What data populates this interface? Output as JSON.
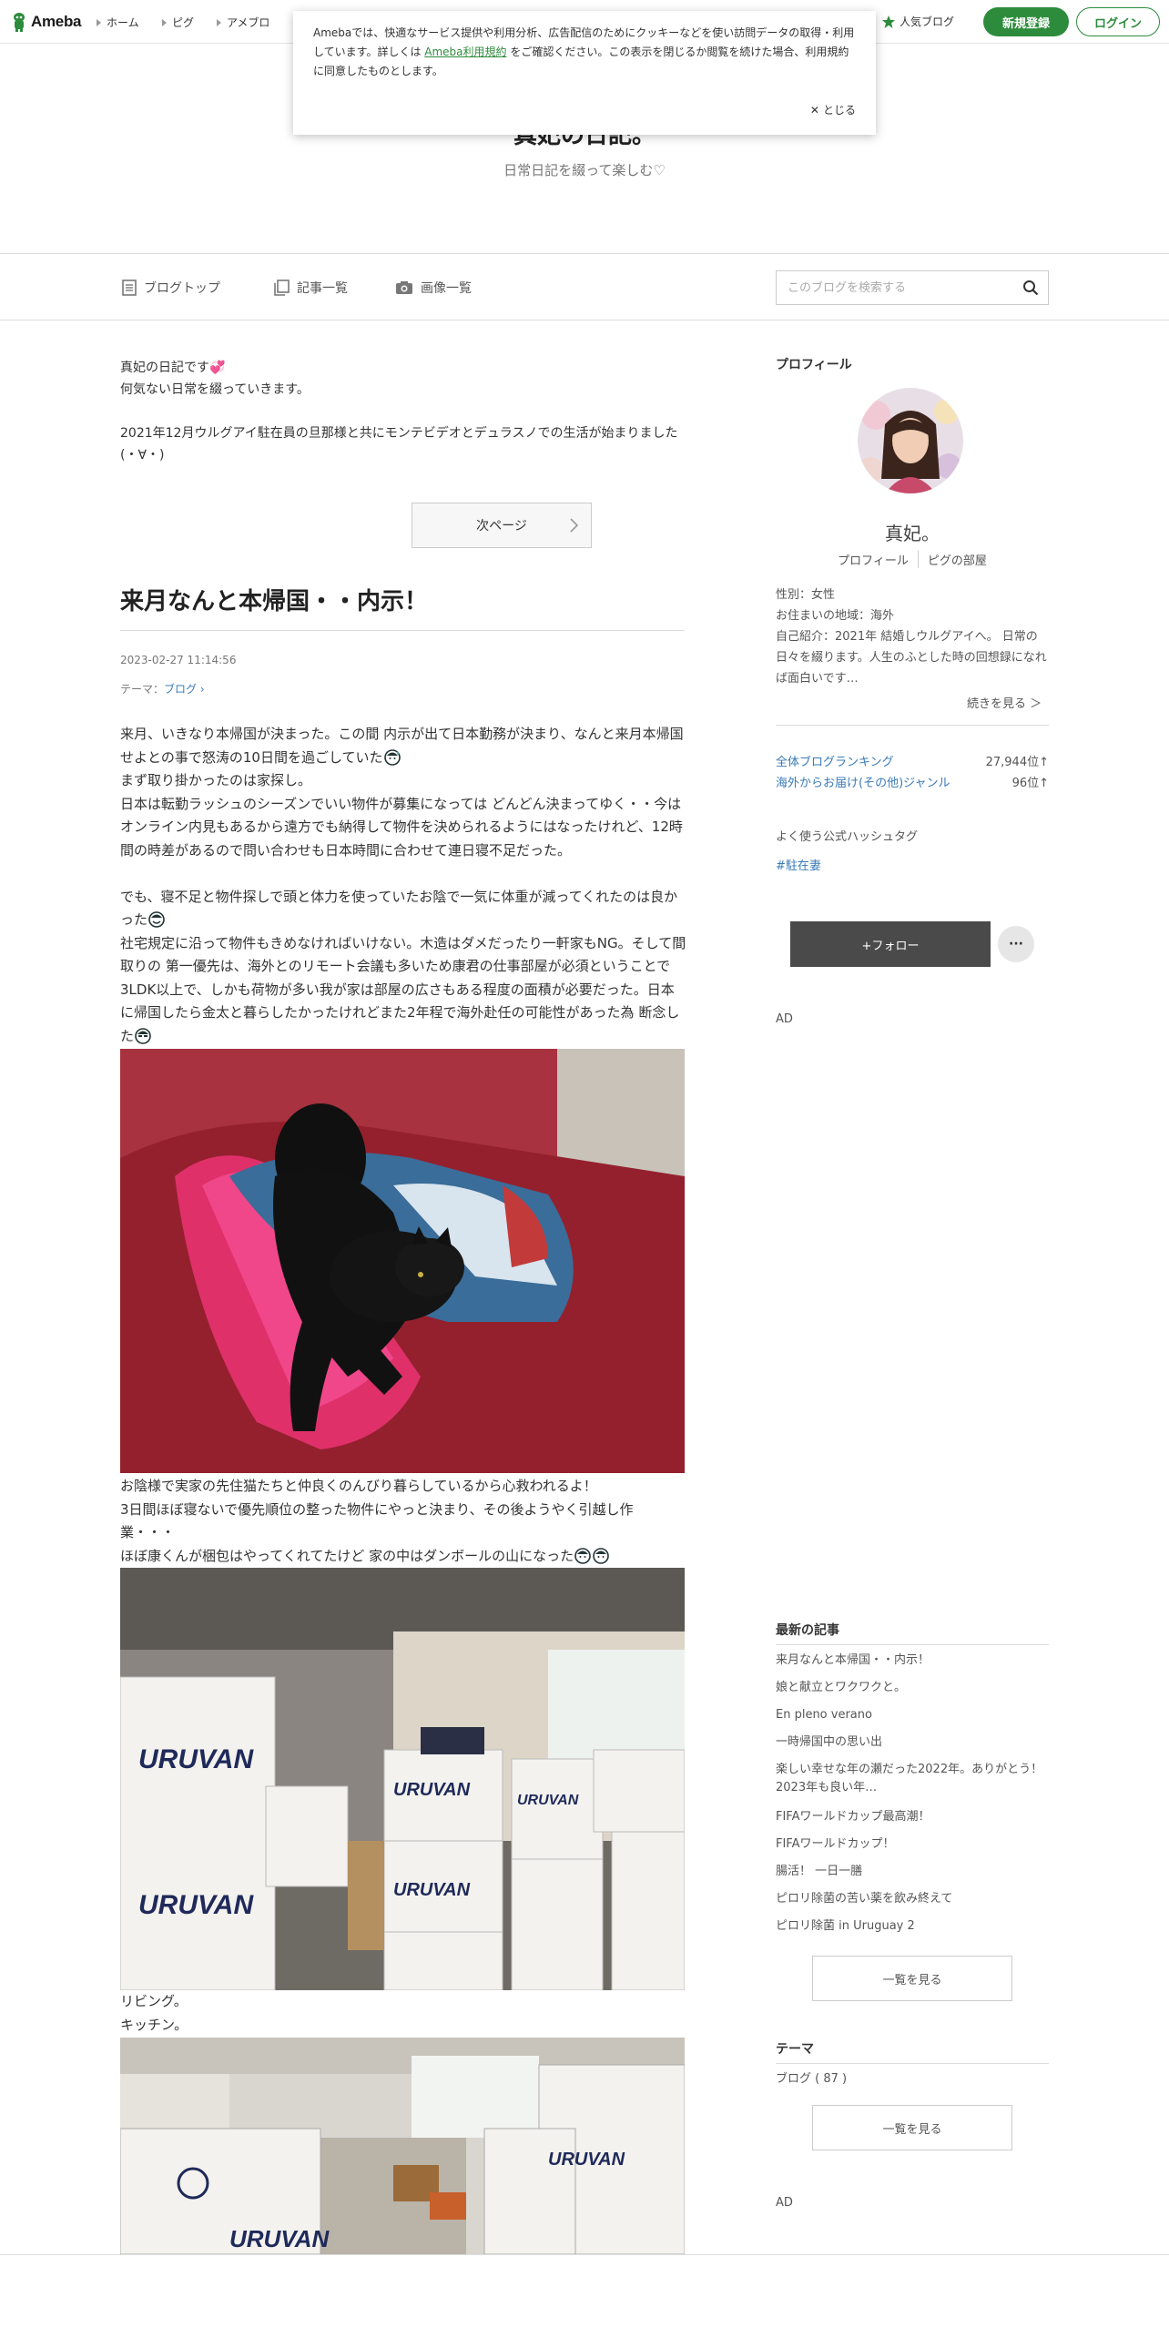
{
  "header": {
    "logo_text": "Ameba",
    "nav": [
      "ホーム",
      "ピグ",
      "アメブロ"
    ],
    "popular_label": "人気ブログ",
    "signup_label": "新規登録",
    "login_label": "ログイン"
  },
  "cookie_banner": {
    "text_1": "Amebaでは、快適なサービス提供や利用分析、広告配信のためにクッキーなどを使い訪問データの取得・利用しています。詳しくは ",
    "link": "Ameba利用規約",
    "text_2": " をご確認ください。この表示を閉じるか閲覧を続けた場合、利用規約に同意したものとします。",
    "close_label": "とじる"
  },
  "blog": {
    "title": "真妃の日記。",
    "description": "日常日記を綴って楽しむ♡"
  },
  "blog_nav": {
    "items": [
      "ブログトップ",
      "記事一覧",
      "画像一覧"
    ],
    "search_placeholder": "このブログを検索する"
  },
  "intro": {
    "line1": "真妃の日記です",
    "line2": "何気ない日常を綴っていきます。",
    "line3": "2021年12月ウルグアイ駐在員の旦那様と共にモンテビデオとデュラスノでの生活が始まりました",
    "line4": "(・∀・)"
  },
  "next_page_label": "次ページ",
  "entry": {
    "title": "来月なんと本帰国・・内示！",
    "date": "2023-02-27 11:14:56",
    "theme_prefix": "テーマ：",
    "theme": "ブログ",
    "p1": "来月、いきなり本帰国が決まった。この間 内示が出て日本勤務が決まり、なんと来月本帰国せよとの事で怒涛の10日間を過ごしていた",
    "p2": "まず取り掛かったのは家探し。",
    "p3": "日本は転勤ラッシュのシーズンでいい物件が募集になっては どんどん決まってゆく・・今はオンライン内見もあるから遠方でも納得して物件を決められるようにはなったけれど、12時間の時差があるので問い合わせも日本時間に合わせて連日寝不足だった。",
    "p4": "でも、寝不足と物件探しで頭と体力を使っていたお陰で一気に体重が減ってくれたのは良かった",
    "p5": "社宅規定に沿って物件もきめなければいけない。木造はダメだったり一軒家もNG。そして間取りの 第一優先は、海外とのリモート会議も多いため康君の仕事部屋が必須ということで3LDK以上で、しかも荷物が多い我が家は部屋の広さもある程度の面積が必要だった。日本に帰国したら金太と暮らしたかったけれどまた2年程で海外赴任の可能性があった為 断念した",
    "p6": "お陰様で実家の先住猫たちと仲良くのんびり暮らしているから心救われるよ！",
    "p7": "3日間ほぼ寝ないで優先順位の整った物件にやっと決まり、その後ようやく引越し作業・・・",
    "p8": "ほぼ康くんが梱包はやってくれてたけど 家の中はダンボールの山になった",
    "p9": "リビング。",
    "p10": "キッチン。",
    "box_brand": "URUVAN"
  },
  "sidebar": {
    "profile_heading": "プロフィール",
    "name": "真妃。",
    "profile_link": "プロフィール",
    "pig_link": "ピグの部屋",
    "gender": "性別：女性",
    "area": "お住まいの地域：海外",
    "intro": "自己紹介：2021年 結婚しウルグアイへ。 日常の日々を綴ります。人生のふとした時の回想録になれば面白いです…",
    "read_more": "続きを見る ＞",
    "rank_all_label": "全体ブログランキング",
    "rank_all_value": "27,944位↑",
    "rank_genre_label": "海外からお届け(その他)ジャンル",
    "rank_genre_value": "96位↑",
    "hashtag_heading": "よく使う公式ハッシュタグ",
    "hashtag": "#駐在妻",
    "follow_label": "+フォロー",
    "more_label": "···",
    "ad1": "AD",
    "recent_heading": "最新の記事",
    "recent": [
      "来月なんと本帰国・・内示！",
      "娘と献立とワクワクと。",
      "En pleno verano",
      "一時帰国中の思い出",
      "楽しい幸せな年の瀬だった2022年。ありがとう！2023年も良い年…",
      "FIFAワールドカップ最高潮！",
      "FIFAワールドカップ！",
      "腸活！ 一日一膳",
      "ピロリ除菌の苦い薬を飲み終えて",
      "ピロリ除菌 in Uruguay 2"
    ],
    "recent_list_btn": "一覧を見る",
    "theme_heading": "テーマ",
    "theme_item": "ブログ ( 87 )",
    "theme_list_btn": "一覧を見る",
    "ad2": "AD"
  },
  "colors": {
    "brand_green": "#2d8c3c",
    "link_blue": "#3a7ab8",
    "follow_bg": "#4a4a4a"
  }
}
